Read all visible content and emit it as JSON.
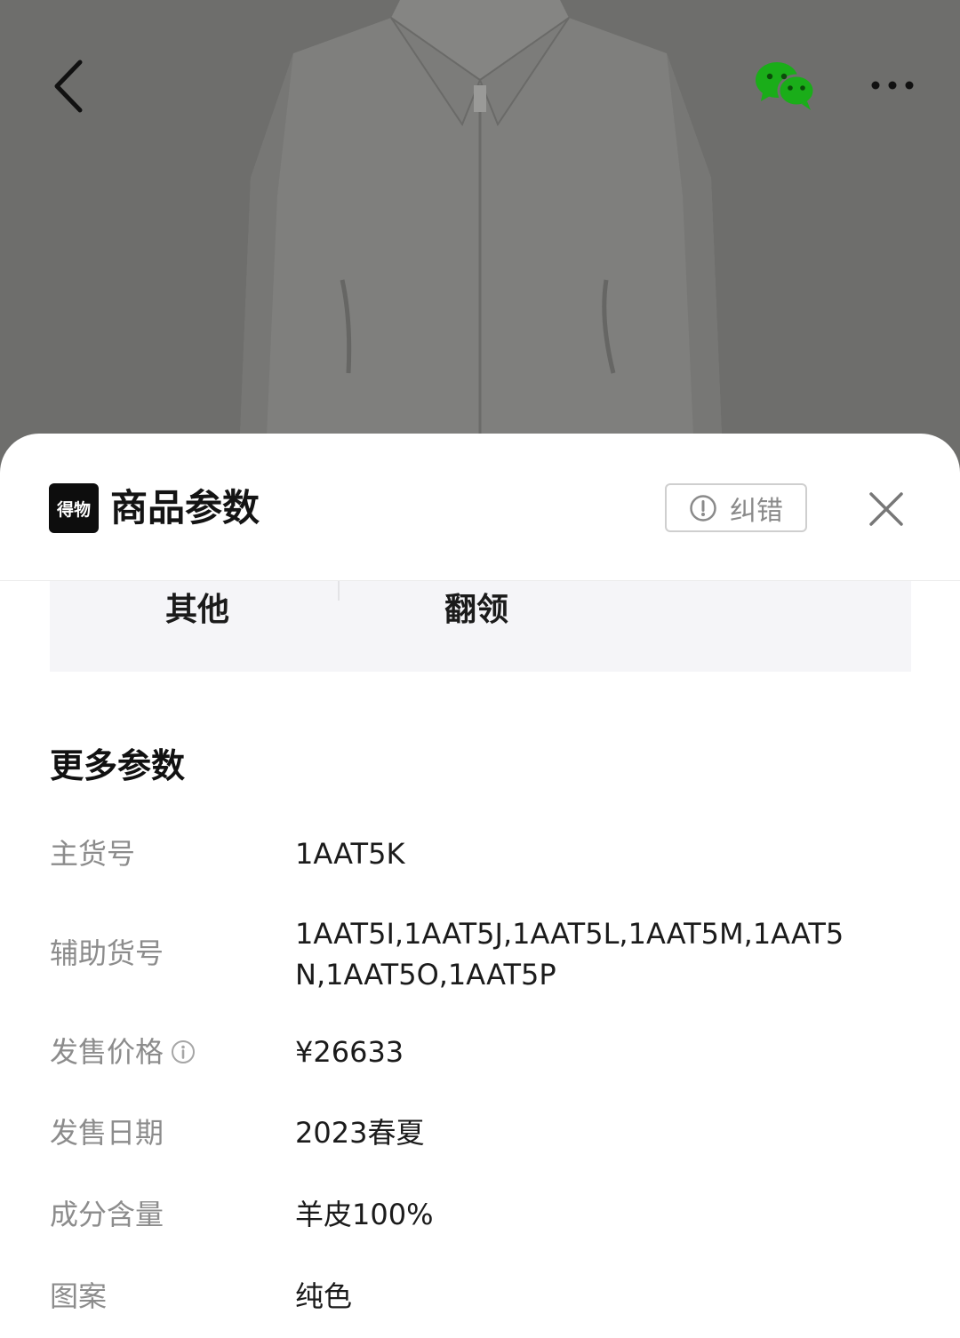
{
  "nav": {
    "back_icon": "chevron-left-icon",
    "share_icon": "wechat-icon",
    "more_icon": "more-dots-icon"
  },
  "colors": {
    "wechat_green": "#1aad19",
    "overlay": "#6e6e6c",
    "label_gray": "#8c8c8c",
    "value_black": "#1b1b1b"
  },
  "sheet": {
    "logo_text": "得物",
    "title": "商品参数",
    "correct_label": "纠错",
    "correct_icon": "exclamation-circle-icon",
    "close_icon": "close-icon"
  },
  "params_top": {
    "key": "其他",
    "value": "翻领"
  },
  "more_params": {
    "title": "更多参数",
    "rows": [
      {
        "label": "主货号",
        "value": "1AAT5K"
      },
      {
        "label": "辅助货号",
        "value": "1AAT5I,1AAT5J,1AAT5L,1AAT5M,1AAT5N,1AAT5O,1AAT5P"
      },
      {
        "label": "发售价格",
        "value": "¥26633",
        "info_icon": "info-icon"
      },
      {
        "label": "发售日期",
        "value": "2023春夏"
      },
      {
        "label": "成分含量",
        "value": "羊皮100%"
      },
      {
        "label": "图案",
        "value": "纯色"
      }
    ]
  }
}
